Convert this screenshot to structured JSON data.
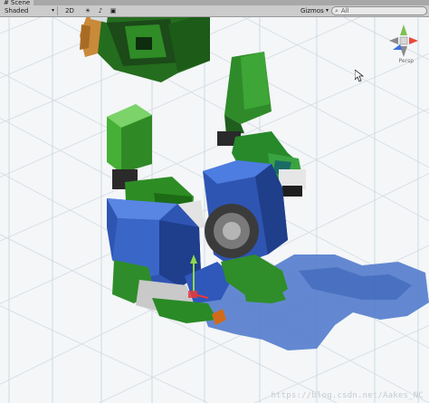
{
  "window": {
    "tab_title": "Scene"
  },
  "toolbar": {
    "shading_mode": "Shaded",
    "mode_2d": "2D",
    "icons": [
      "sun-icon",
      "audio-icon",
      "image-icon"
    ],
    "gizmos_label": "Gizmos",
    "search_value": "All"
  },
  "gizmo": {
    "projection_label": "Persp"
  },
  "watermark": {
    "text": "https://blog.csdn.net/Aakes_NC"
  }
}
